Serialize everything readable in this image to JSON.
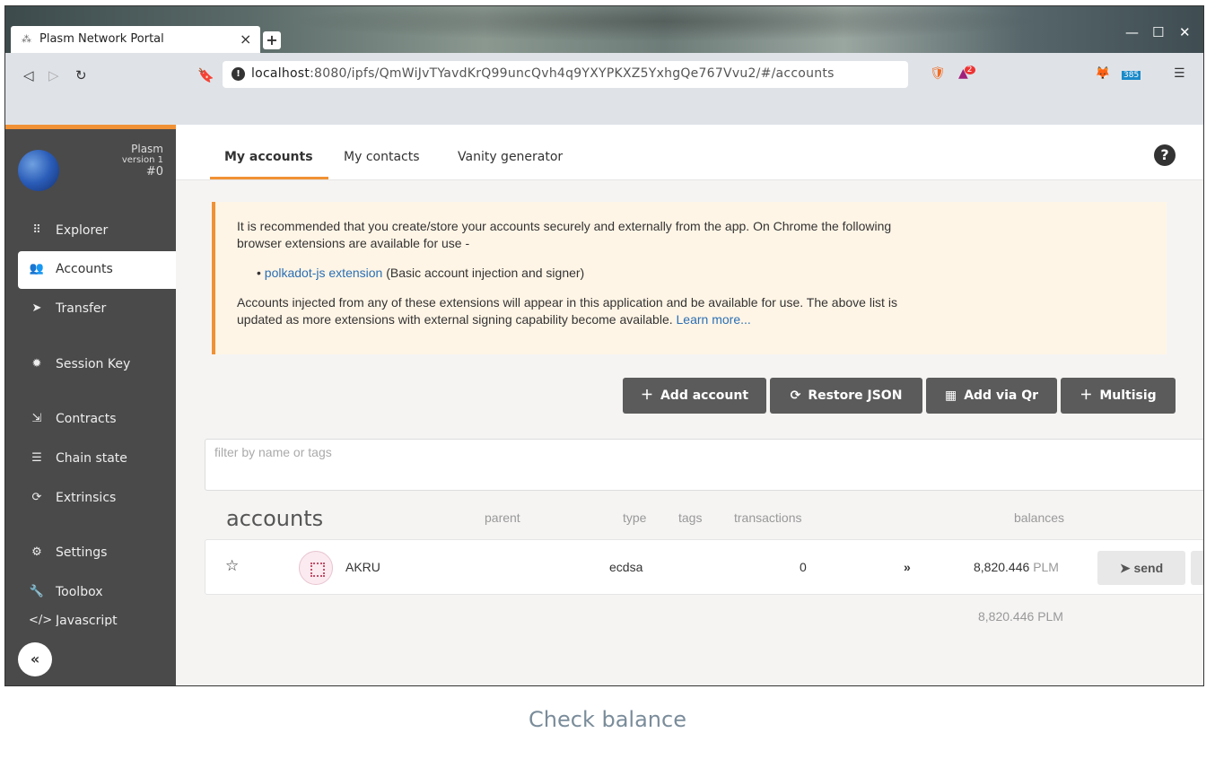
{
  "browser": {
    "tab_title": "Plasm Network Portal",
    "tab_close": "×",
    "new_tab": "+",
    "url_host": "localhost",
    "url_rest": ":8080/ipfs/QmWiJvTYavdKrQ99uncQvh4q9YXYPKXZ5YxhgQe767Vvu2/#/accounts",
    "brave_badge": "2",
    "ext_badge": "385",
    "menu": "☰"
  },
  "sidebar": {
    "chain_name": "Plasm",
    "version": "version 1",
    "block": "#0",
    "items": [
      {
        "label": "Explorer",
        "icon": "explorer-icon"
      },
      {
        "label": "Accounts",
        "icon": "users-icon"
      },
      {
        "label": "Transfer",
        "icon": "paper-plane-icon"
      },
      {
        "label": "Session Key",
        "icon": "certificate-icon"
      },
      {
        "label": "Contracts",
        "icon": "compress-icon"
      },
      {
        "label": "Chain state",
        "icon": "database-icon"
      },
      {
        "label": "Extrinsics",
        "icon": "sync-icon"
      },
      {
        "label": "Settings",
        "icon": "cogs-icon"
      },
      {
        "label": "Toolbox",
        "icon": "wrench-icon"
      },
      {
        "label": "Javascript",
        "icon": "code-icon"
      }
    ],
    "collapse_label": "«"
  },
  "main": {
    "tabs": [
      "My accounts",
      "My contacts",
      "Vanity generator"
    ],
    "help": "?",
    "notice": {
      "line1": "It is recommended that you create/store your accounts securely and externally from the app. On Chrome the following browser extensions are available for use -",
      "ext_link": "polkadot-js extension",
      "ext_desc": " (Basic account injection and signer)",
      "line2": "Accounts injected from any of these extensions will appear in this application and be available for use. The above list is updated as more extensions with external signing capability become available. ",
      "learn_more": "Learn more..."
    },
    "buttons": {
      "add_account": "Add account",
      "restore_json": "Restore JSON",
      "add_via_qr": "Add via Qr",
      "multisig": "Multisig"
    },
    "filter_placeholder": "filter by name or tags",
    "table": {
      "title": "accounts",
      "headers": {
        "parent": "parent",
        "type": "type",
        "tags": "tags",
        "transactions": "transactions",
        "balances": "balances"
      },
      "rows": [
        {
          "name": "AKRU",
          "type": "ecdsa",
          "transactions": "0",
          "balance": "8,820.446",
          "unit": "PLM",
          "send": "send"
        }
      ],
      "total_balance": "8,820.446",
      "total_unit": "PLM"
    }
  },
  "caption": "Check balance",
  "colors": {
    "accent": "#f19135",
    "sidebar": "#4a4a4a",
    "button": "#5b5b5b",
    "link": "#2a6fb4"
  }
}
